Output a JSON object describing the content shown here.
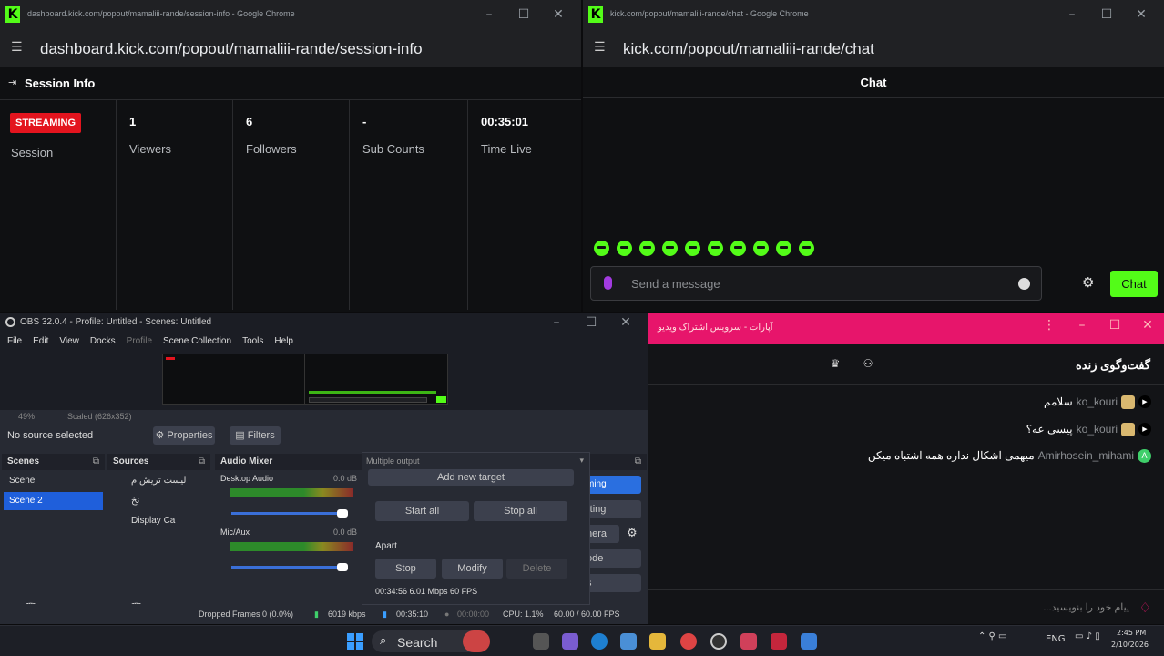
{
  "session_window": {
    "title": "dashboard.kick.com/popout/mamaliii-rande/session-info - Google Chrome",
    "url": "dashboard.kick.com/popout/mamaliii-rande/session-info",
    "header": "Session Info",
    "status_badge": "STREAMING",
    "stats": [
      {
        "value": "",
        "label": "Session"
      },
      {
        "value": "1",
        "label": "Viewers"
      },
      {
        "value": "6",
        "label": "Followers"
      },
      {
        "value": "-",
        "label": "Sub Counts"
      },
      {
        "value": "00:35:01",
        "label": "Time Live"
      }
    ]
  },
  "chat_window": {
    "title": "kick.com/popout/mamaliii-rande/chat - Google Chrome",
    "url": "kick.com/popout/mamaliii-rande/chat",
    "header": "Chat",
    "placeholder": "Send a message",
    "send_label": "Chat",
    "accent": "#53fc18"
  },
  "obs": {
    "title": "OBS 32.0.4 - Profile: Untitled - Scenes: Untitled",
    "menu": [
      "File",
      "Edit",
      "View",
      "Docks",
      "Profile",
      "Scene Collection",
      "Tools",
      "Help"
    ],
    "zoom": "49%",
    "scale": "Scaled (626x352)",
    "no_source": "No source selected",
    "properties": "Properties",
    "filters": "Filters",
    "scenes_title": "Scenes",
    "scenes": [
      "Scene",
      "Scene 2"
    ],
    "sources_title": "Sources",
    "sources": [
      "لیست تریش م",
      "نخ",
      "Display Ca"
    ],
    "mixer_title": "Audio Mixer",
    "channels": [
      {
        "name": "Desktop Audio",
        "db": "0.0 dB"
      },
      {
        "name": "Mic/Aux",
        "db": "0.0 dB"
      }
    ],
    "controls": [
      "ming",
      "rting",
      "nera",
      "ode",
      "s"
    ],
    "status": {
      "dropped": "Dropped Frames 0 (0.0%)",
      "kbps": "6019 kbps",
      "stream_time": "00:35:10",
      "rec_time": "00:00:00",
      "cpu": "CPU: 1.1%",
      "fps": "60.00 / 60.00 FPS"
    }
  },
  "multiple_output": {
    "title": "Multiple output",
    "add_target": "Add new target",
    "start_all": "Start all",
    "stop_all": "Stop all",
    "target_name": "Apart",
    "stop": "Stop",
    "modify": "Modify",
    "delete": "Delete",
    "info": "00:34:56  6.01 Mbps  60 FPS"
  },
  "persian_chat": {
    "title": "آپارات - سرویس اشتراک ویدیو",
    "header": "گفت‌وگوی زنده",
    "messages": [
      {
        "user": "ko_kouri",
        "text": "سلامم"
      },
      {
        "user": "ko_kouri",
        "text": "پیسی عه؟"
      },
      {
        "user": "Amirhosein_mihami",
        "text": "میهمی اشکال نداره همه اشتباه میکن"
      }
    ],
    "placeholder": "پیام خود را بنویسید...",
    "accent": "#e7156b"
  },
  "taskbar": {
    "search": "Search",
    "lang": "ENG",
    "time": "2:45 PM",
    "date": "2/10/2026"
  }
}
